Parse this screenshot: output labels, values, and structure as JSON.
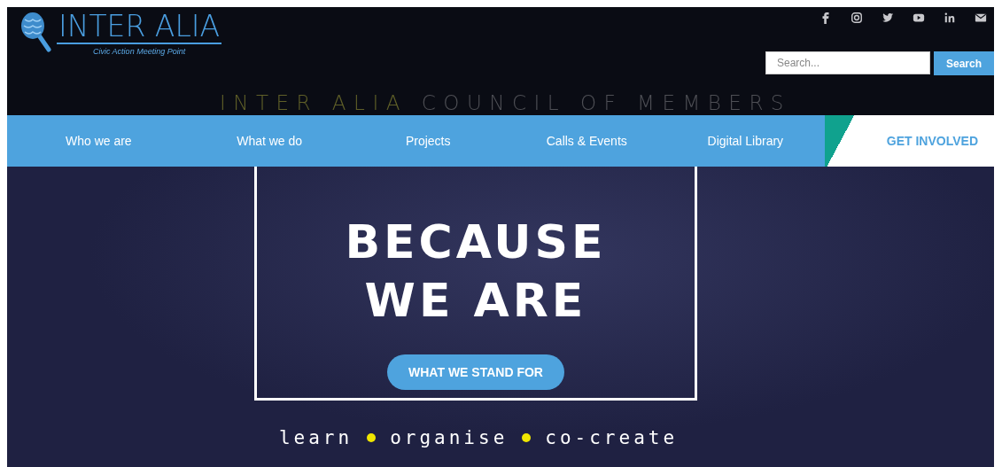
{
  "header": {
    "logo": {
      "title": "INTER ALIA",
      "subtitle": "Civic Action Meeting Point"
    },
    "social": [
      {
        "kind": "facebook"
      },
      {
        "kind": "instagram"
      },
      {
        "kind": "twitter"
      },
      {
        "kind": "youtube"
      },
      {
        "kind": "linkedin"
      },
      {
        "kind": "email"
      }
    ],
    "search": {
      "placeholder": "Search...",
      "button": "Search"
    },
    "banner": {
      "highlight": "INTER ALIA",
      "rest": "COUNCIL OF MEMBERS"
    }
  },
  "nav": [
    {
      "label": "Who we are",
      "kind": "link"
    },
    {
      "label": "What we do",
      "kind": "link"
    },
    {
      "label": "Projects",
      "kind": "link"
    },
    {
      "label": "Calls & Events",
      "kind": "link"
    },
    {
      "label": "Digital Library",
      "kind": "link"
    },
    {
      "label": "GET INVOLVED",
      "kind": "cta"
    }
  ],
  "hero": {
    "heading": [
      "BECAUSE",
      "WE ARE"
    ],
    "button": "WHAT WE STAND FOR",
    "tagline": [
      "learn",
      "organise",
      "co-create"
    ]
  }
}
